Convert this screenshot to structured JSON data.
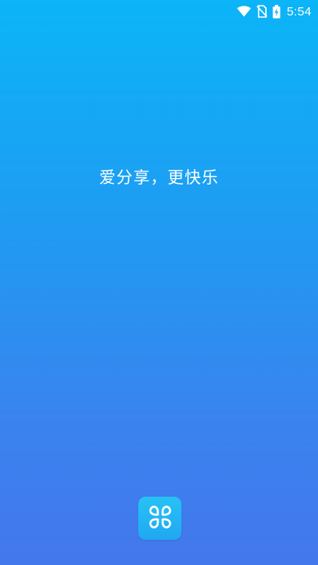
{
  "status_bar": {
    "time": "5:54",
    "icons": [
      "wifi-icon",
      "no-sim-icon",
      "battery-charging-icon"
    ]
  },
  "splash": {
    "slogan": "爱分享，更快乐",
    "logo_icon": "app-logo-icon"
  },
  "colors": {
    "gradient_top": "#0bb5f7",
    "gradient_bottom": "#4377ec",
    "logo_bg": "#20a8f1",
    "text": "#ffffff"
  }
}
